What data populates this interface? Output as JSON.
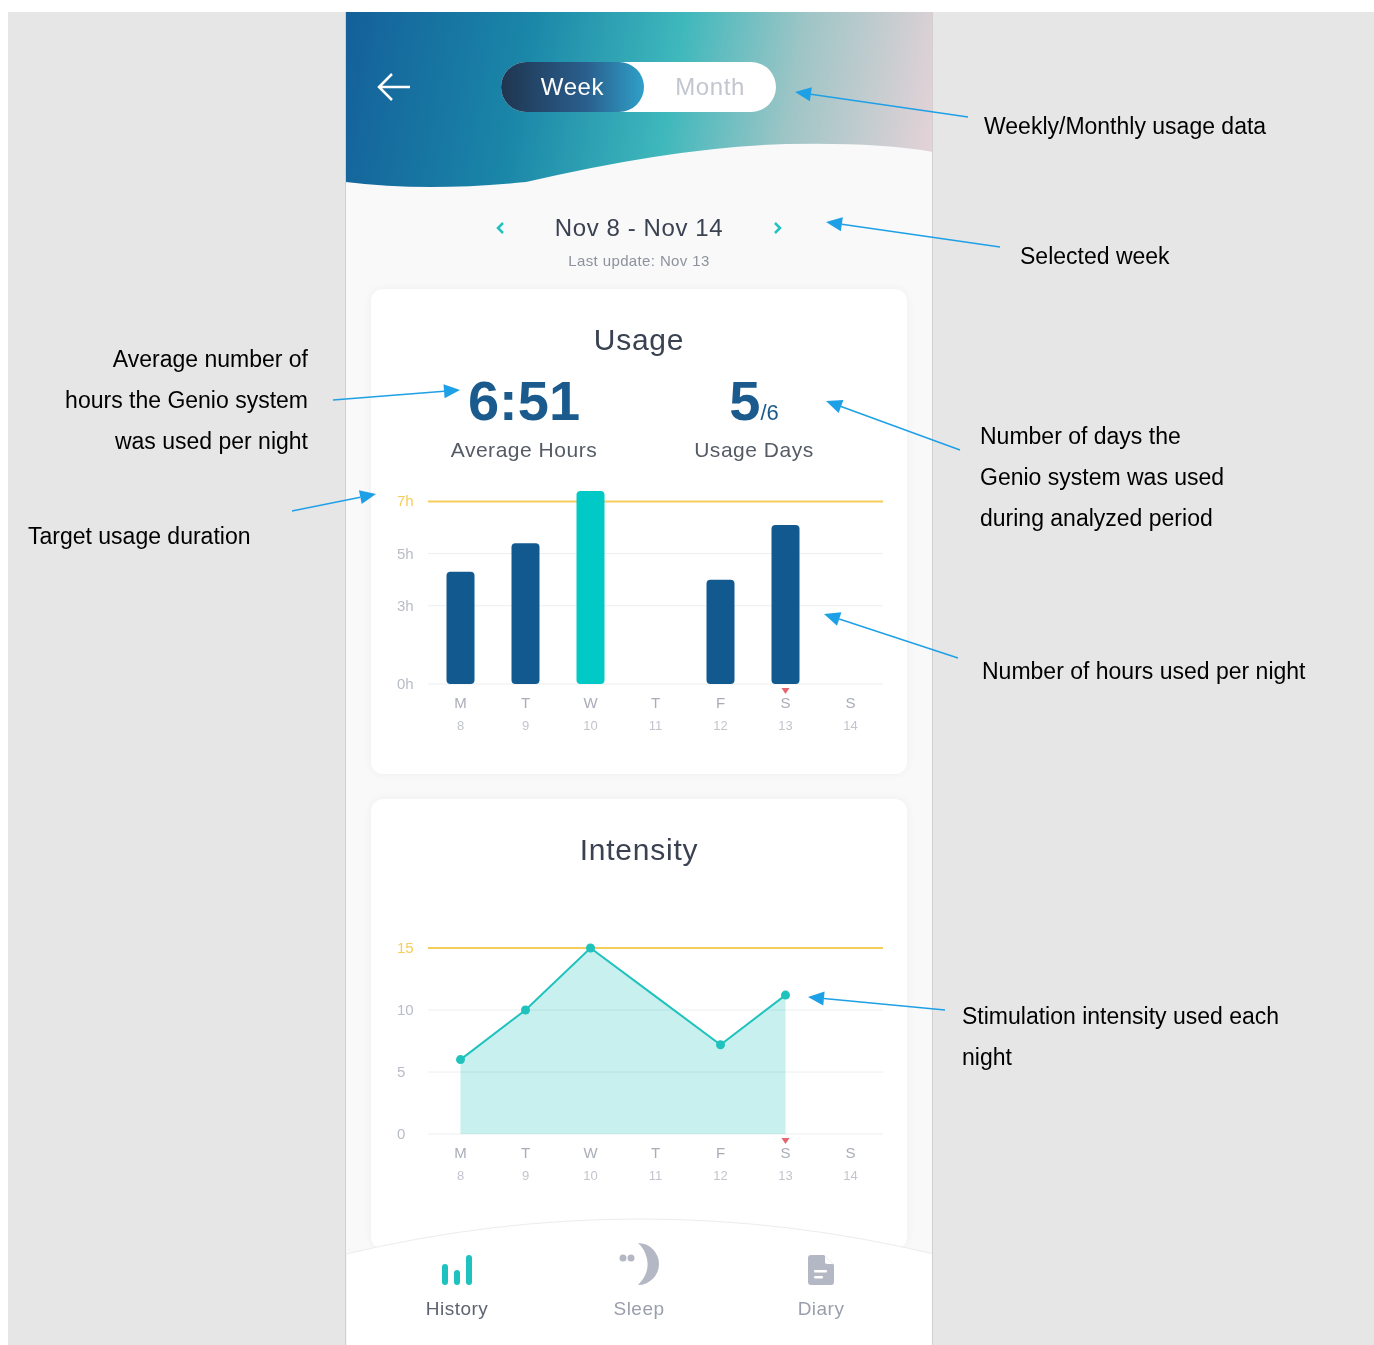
{
  "header": {
    "tabs": [
      {
        "label": "Week",
        "selected": true
      },
      {
        "label": "Month",
        "selected": false
      }
    ]
  },
  "period": {
    "range": "Nov 8 - Nov 14",
    "last_update": "Last update: Nov 13"
  },
  "usage": {
    "title": "Usage",
    "stats": [
      {
        "value": "6:51",
        "label": "Average Hours"
      },
      {
        "value": "5",
        "total": "/6",
        "label": "Usage Days"
      }
    ],
    "days": [
      {
        "date": "8",
        "today": false
      },
      {
        "date": "9",
        "today": false
      },
      {
        "date": "10",
        "today": false
      },
      {
        "date": "11",
        "today": false
      },
      {
        "date": "12",
        "today": false
      },
      {
        "date": "13",
        "today": true
      },
      {
        "date": "14",
        "today": false
      }
    ],
    "chart_data": {
      "type": "bar",
      "categories": [
        "M",
        "T",
        "W",
        "T",
        "F",
        "S",
        "S"
      ],
      "series": [
        {
          "color": "#12598f",
          "values": [
            4.3,
            5.4,
            null,
            null,
            4.0,
            6.1,
            null
          ]
        },
        {
          "color": "#00c9c6",
          "values": [
            null,
            null,
            7.4,
            null,
            null,
            null,
            null
          ]
        }
      ],
      "ylim": [
        0,
        7.4
      ],
      "yticks": [
        {
          "value": 0,
          "label": "0h"
        },
        {
          "value": 3,
          "label": "3h"
        },
        {
          "value": 5,
          "label": "5h"
        },
        {
          "value": 7,
          "label": "7h"
        }
      ],
      "ref_lines": [
        {
          "axis": "y",
          "value": 7,
          "color": "#f5cd5b"
        }
      ]
    }
  },
  "intensity": {
    "title": "Intensity",
    "days": [
      {
        "date": "8",
        "today": false,
        "dot": true
      },
      {
        "date": "9",
        "today": false,
        "dot": true
      },
      {
        "date": "10",
        "today": false,
        "dot": true
      },
      {
        "date": "11",
        "today": false,
        "dot": false
      },
      {
        "date": "12",
        "today": false,
        "dot": true
      },
      {
        "date": "13",
        "today": true,
        "dot": true
      },
      {
        "date": "14",
        "today": false,
        "dot": false
      }
    ],
    "chart_data": {
      "type": "area",
      "categories": [
        "M",
        "T",
        "W",
        "T",
        "F",
        "S",
        "S"
      ],
      "series": [
        {
          "color": "#1fc2bd",
          "values": [
            6,
            10,
            15,
            11.1,
            7.2,
            11.2,
            null
          ]
        }
      ],
      "ylim": [
        0,
        15
      ],
      "yticks": [
        0,
        5,
        10,
        15
      ],
      "ref_lines": [
        {
          "axis": "y",
          "value": 15,
          "color": "#f5cd5b"
        }
      ]
    }
  },
  "nav": [
    {
      "label": "History",
      "kind": "history",
      "selected": true
    },
    {
      "label": "Sleep",
      "kind": "sleep",
      "selected": false
    },
    {
      "label": "Diary",
      "kind": "diary",
      "selected": false
    }
  ],
  "annotations": [
    {
      "text": "Weekly/Monthly usage data"
    },
    {
      "text": "Selected week"
    },
    {
      "text": "Average number of\nhours the Genio system\nwas used per night"
    },
    {
      "text": "Target usage duration"
    },
    {
      "text": "Number of days the\nGenio system was used\nduring analyzed period"
    },
    {
      "text": "Number of hours used per night"
    },
    {
      "text": "Stimulation intensity used each\nnight"
    }
  ]
}
